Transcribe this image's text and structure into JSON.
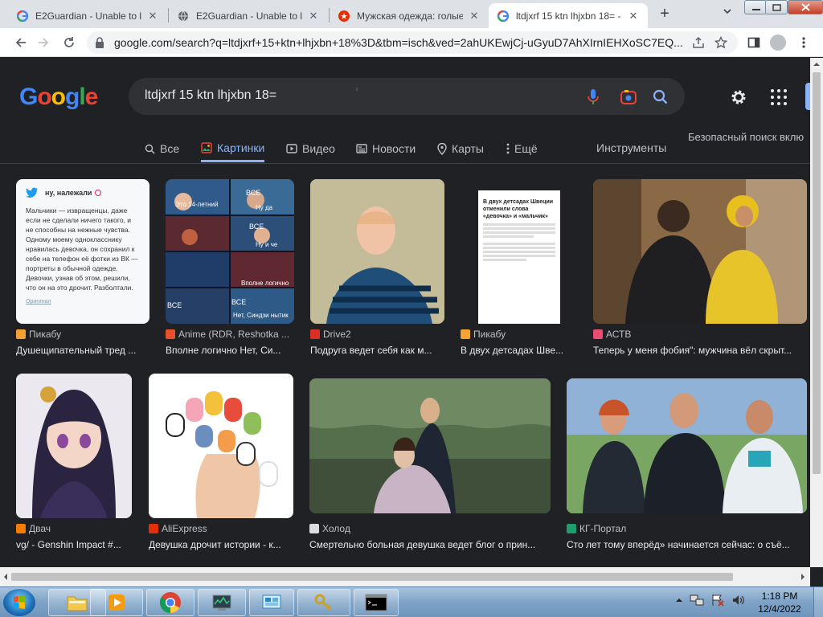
{
  "browser": {
    "tabs": [
      {
        "title": "E2Guardian - Unable to lo",
        "icon": "google-g-icon",
        "active": false
      },
      {
        "title": "E2Guardian - Unable to lo",
        "icon": "globe-icon",
        "active": false
      },
      {
        "title": "Мужская одежда: голые",
        "icon": "aliexpress-icon",
        "active": false
      },
      {
        "title": "ltdjxrf 15 ktn lhjxbn 18= -",
        "icon": "google-g-icon",
        "active": true
      }
    ],
    "url": "google.com/search?q=ltdjxrf+15+ktn+lhjxbn+18%3D&tbm=isch&ved=2ahUKEwjCj-uGyuD7AhXIrnIEHXoSC7EQ..."
  },
  "google": {
    "logo_letters": [
      {
        "ch": "G",
        "color": "#4285f4"
      },
      {
        "ch": "o",
        "color": "#ea4335"
      },
      {
        "ch": "o",
        "color": "#fbbc05"
      },
      {
        "ch": "g",
        "color": "#4285f4"
      },
      {
        "ch": "l",
        "color": "#34a853"
      },
      {
        "ch": "e",
        "color": "#ea4335"
      }
    ],
    "query": "ltdjxrf 15 ktn lhjxbn 18=",
    "tabs": [
      {
        "label": "Все",
        "icon": "search-icon"
      },
      {
        "label": "Картинки",
        "icon": "images-icon",
        "active": true
      },
      {
        "label": "Видео",
        "icon": "video-icon"
      },
      {
        "label": "Новости",
        "icon": "news-icon"
      },
      {
        "label": "Карты",
        "icon": "map-pin-icon"
      },
      {
        "label": "Ещё",
        "icon": "more-vert-icon"
      }
    ],
    "tools_label": "Инструменты",
    "safe_search_label": "Безопасный поиск вклю"
  },
  "results": [
    {
      "source": "Пикабу",
      "caption": "Душещипательный тред ...",
      "fav_color": "#f4a234",
      "card_text": {
        "head": "ну, належали",
        "body": "Мальчики — извращенцы, даже если не сделали ничего такого, и не способны на нежные чувства. Одному моему однокласснику нравилась девочка, он сохранил к себе на телефон её фотки из ВК — портреты в обычной одежде. Девочки, узнав об этом, решили, что он на это дрочит. Разболтали.",
        "footer": "Оригинал"
      }
    },
    {
      "source": "Anime (RDR, Reshotka ...",
      "caption": "Вполне логично Нет, Си...",
      "fav_color": "#e8502a",
      "meme_texts": [
        "ВСЕ",
        "Это 14-летний мальчик, так?",
        "Ну да",
        "ВСЕ",
        "Ну и че",
        "Вполне логично",
        "ВСЕ",
        "ВСЕ",
        "Нет, Синдзи нытик"
      ]
    },
    {
      "source": "Drive2",
      "caption": "Подруга ведет себя как м...",
      "fav_color": "#d93025"
    },
    {
      "source": "Пикабу",
      "caption": "В двух детсадах Шве...",
      "fav_color": "#f4a234",
      "article": {
        "headline": "В двух детсадах Швеции отменили слова «девочка» и «мальчик»"
      }
    },
    {
      "source": "АСТВ",
      "caption": "Теперь у меня фобия\": мужчина вёл скрыт...",
      "fav_color": "#e94c6f"
    },
    {
      "source": "Двач",
      "caption": "vg/ - Genshin Impact #...",
      "fav_color": "#f57c00"
    },
    {
      "source": "AliExpress",
      "caption": "Девушка дрочит истории - к...",
      "fav_color": "#e62e04"
    },
    {
      "source": "Холод",
      "caption": "Смертельно больная девушка ведет блог о прин...",
      "fav_color": "#dadce0"
    },
    {
      "source": "КГ-Портал",
      "caption": "Сто лет тому вперёд» начинается сейчас: о съё...",
      "fav_color": "#1e9e6a"
    }
  ],
  "taskbar": {
    "time": "1:18 PM",
    "date": "12/4/2022",
    "items": [
      "explorer-icon",
      "media-player-icon",
      "chrome-icon",
      "task-manager-icon",
      "control-panel-icon",
      "keys-icon",
      "cmd-icon"
    ]
  }
}
